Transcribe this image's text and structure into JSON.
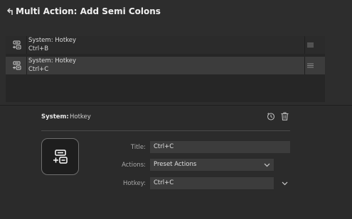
{
  "header": {
    "title": "Multi Action: Add Semi Colons"
  },
  "actions_list": [
    {
      "line1": "System: Hotkey",
      "line2": "Ctrl+B",
      "selected": false
    },
    {
      "line1": "System: Hotkey",
      "line2": "Ctrl+C",
      "selected": true
    }
  ],
  "inspector": {
    "category": "System:",
    "action_name": "Hotkey",
    "title_label": "Title:",
    "title_value": "Ctrl+C",
    "actions_label": "Actions:",
    "actions_value": "Preset Actions",
    "hotkey_label": "Hotkey:",
    "hotkey_value": "Ctrl+C"
  },
  "colors": {
    "background": "#2d2d2d",
    "list_background": "#262626",
    "selected_row": "#3c3c3c",
    "field": "#3c3c3c"
  }
}
